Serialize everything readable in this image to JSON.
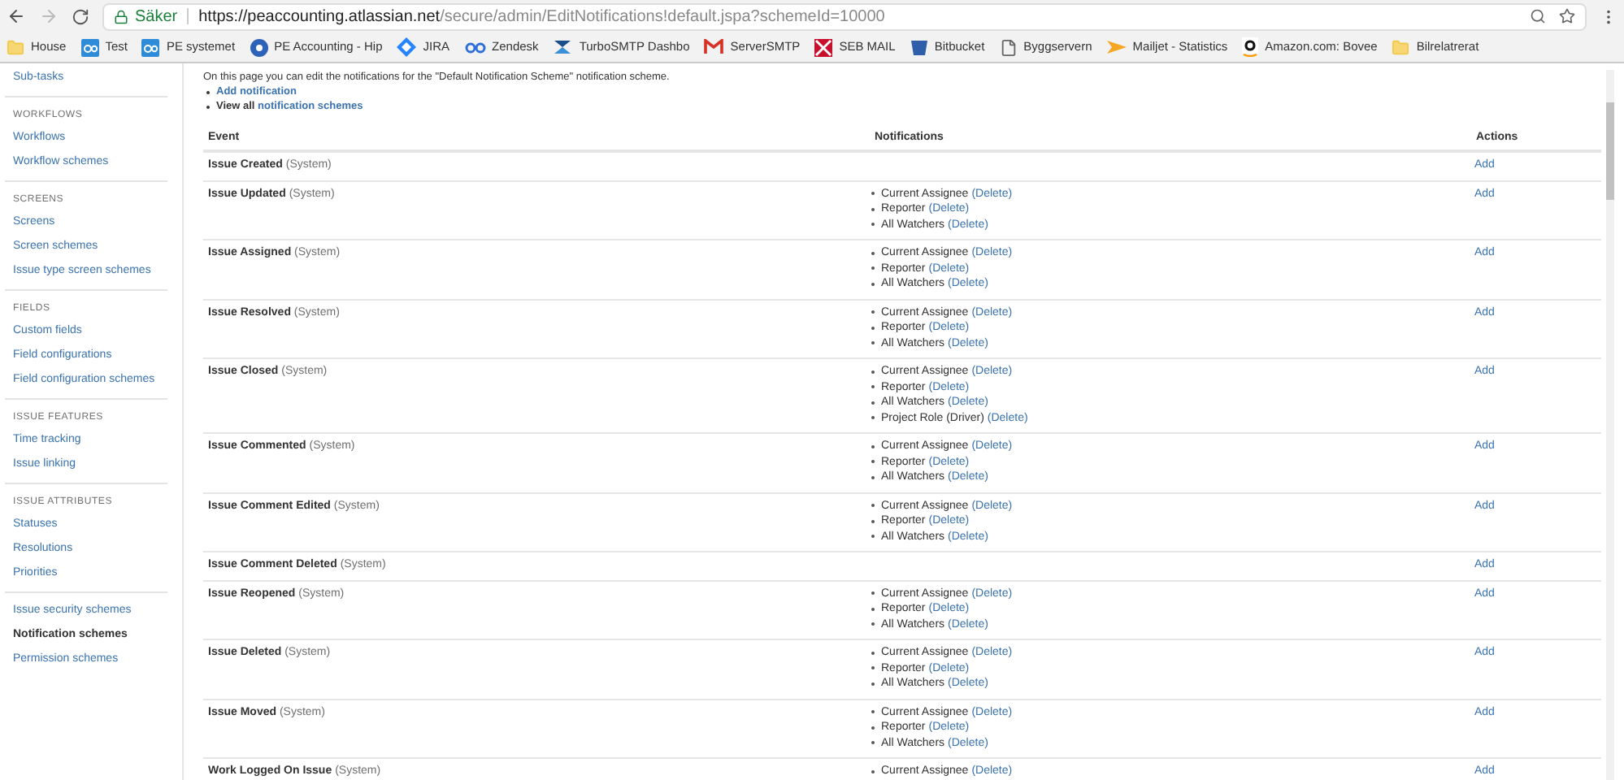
{
  "browser": {
    "secure_label": "Säker",
    "url_host": "https://peaccounting.atlassian.net",
    "url_path": "/secure/admin/EditNotifications!default.jspa?schemeId=10000"
  },
  "bookmarks": [
    {
      "kind": "folder",
      "label": "House"
    },
    {
      "kind": "pe",
      "label": "Test"
    },
    {
      "kind": "pe",
      "label": "PE systemet"
    },
    {
      "kind": "chat",
      "label": "PE Accounting - Hip"
    },
    {
      "kind": "jira",
      "label": "JIRA"
    },
    {
      "kind": "pe-text",
      "label": "Zendesk"
    },
    {
      "kind": "turbo",
      "label": "TurboSMTP Dashbo"
    },
    {
      "kind": "gmail",
      "label": "ServerSMTP"
    },
    {
      "kind": "seb",
      "label": "SEB MAIL"
    },
    {
      "kind": "bitbucket",
      "label": "Bitbucket"
    },
    {
      "kind": "page",
      "label": "Byggservern"
    },
    {
      "kind": "mailjet",
      "label": "Mailjet - Statistics"
    },
    {
      "kind": "amazon",
      "label": "Amazon.com: Bovee"
    },
    {
      "kind": "folder",
      "label": "Bilrelatrerat"
    }
  ],
  "sidebar": [
    {
      "items": [
        {
          "label": "Sub-tasks",
          "selected": false
        }
      ]
    },
    {
      "heading": "WORKFLOWS",
      "items": [
        {
          "label": "Workflows",
          "selected": false
        },
        {
          "label": "Workflow schemes",
          "selected": false
        }
      ]
    },
    {
      "heading": "SCREENS",
      "items": [
        {
          "label": "Screens",
          "selected": false
        },
        {
          "label": "Screen schemes",
          "selected": false
        },
        {
          "label": "Issue type screen schemes",
          "selected": false
        }
      ]
    },
    {
      "heading": "FIELDS",
      "items": [
        {
          "label": "Custom fields",
          "selected": false
        },
        {
          "label": "Field configurations",
          "selected": false
        },
        {
          "label": "Field configuration schemes",
          "selected": false
        }
      ]
    },
    {
      "heading": "ISSUE FEATURES",
      "items": [
        {
          "label": "Time tracking",
          "selected": false
        },
        {
          "label": "Issue linking",
          "selected": false
        }
      ]
    },
    {
      "heading": "ISSUE ATTRIBUTES",
      "items": [
        {
          "label": "Statuses",
          "selected": false
        },
        {
          "label": "Resolutions",
          "selected": false
        },
        {
          "label": "Priorities",
          "selected": false
        }
      ]
    },
    {
      "items": [
        {
          "label": "Issue security schemes",
          "selected": false
        },
        {
          "label": "Notification schemes",
          "selected": true
        },
        {
          "label": "Permission schemes",
          "selected": false
        }
      ]
    }
  ],
  "intro": {
    "text": "On this page you can edit the notifications for the \"Default Notification Scheme\" notification scheme.",
    "add_link": "Add notification",
    "view_all_prefix": "View all",
    "view_all_link": "notification schemes"
  },
  "table": {
    "columns": [
      "Event",
      "Notifications",
      "Actions"
    ],
    "rows": [
      {
        "event": "Issue Created",
        "tag": "(System)",
        "notifications": [],
        "action": "Add"
      },
      {
        "event": "Issue Updated",
        "tag": "(System)",
        "notifications": [
          {
            "label": "Current Assignee",
            "action": "(Delete)"
          },
          {
            "label": "Reporter",
            "action": "(Delete)"
          },
          {
            "label": "All Watchers",
            "action": "(Delete)"
          }
        ],
        "action": "Add"
      },
      {
        "event": "Issue Assigned",
        "tag": "(System)",
        "notifications": [
          {
            "label": "Current Assignee",
            "action": "(Delete)"
          },
          {
            "label": "Reporter",
            "action": "(Delete)"
          },
          {
            "label": "All Watchers",
            "action": "(Delete)"
          }
        ],
        "action": "Add"
      },
      {
        "event": "Issue Resolved",
        "tag": "(System)",
        "notifications": [
          {
            "label": "Current Assignee",
            "action": "(Delete)"
          },
          {
            "label": "Reporter",
            "action": "(Delete)"
          },
          {
            "label": "All Watchers",
            "action": "(Delete)"
          }
        ],
        "action": "Add"
      },
      {
        "event": "Issue Closed",
        "tag": "(System)",
        "notifications": [
          {
            "label": "Current Assignee",
            "action": "(Delete)"
          },
          {
            "label": "Reporter",
            "action": "(Delete)"
          },
          {
            "label": "All Watchers",
            "action": "(Delete)"
          },
          {
            "label": "Project Role (Driver)",
            "action": "(Delete)"
          }
        ],
        "action": "Add"
      },
      {
        "event": "Issue Commented",
        "tag": "(System)",
        "notifications": [
          {
            "label": "Current Assignee",
            "action": "(Delete)"
          },
          {
            "label": "Reporter",
            "action": "(Delete)"
          },
          {
            "label": "All Watchers",
            "action": "(Delete)"
          }
        ],
        "action": "Add"
      },
      {
        "event": "Issue Comment Edited",
        "tag": "(System)",
        "notifications": [
          {
            "label": "Current Assignee",
            "action": "(Delete)"
          },
          {
            "label": "Reporter",
            "action": "(Delete)"
          },
          {
            "label": "All Watchers",
            "action": "(Delete)"
          }
        ],
        "action": "Add"
      },
      {
        "event": "Issue Comment Deleted",
        "tag": "(System)",
        "notifications": [],
        "action": "Add"
      },
      {
        "event": "Issue Reopened",
        "tag": "(System)",
        "notifications": [
          {
            "label": "Current Assignee",
            "action": "(Delete)"
          },
          {
            "label": "Reporter",
            "action": "(Delete)"
          },
          {
            "label": "All Watchers",
            "action": "(Delete)"
          }
        ],
        "action": "Add"
      },
      {
        "event": "Issue Deleted",
        "tag": "(System)",
        "notifications": [
          {
            "label": "Current Assignee",
            "action": "(Delete)"
          },
          {
            "label": "Reporter",
            "action": "(Delete)"
          },
          {
            "label": "All Watchers",
            "action": "(Delete)"
          }
        ],
        "action": "Add"
      },
      {
        "event": "Issue Moved",
        "tag": "(System)",
        "notifications": [
          {
            "label": "Current Assignee",
            "action": "(Delete)"
          },
          {
            "label": "Reporter",
            "action": "(Delete)"
          },
          {
            "label": "All Watchers",
            "action": "(Delete)"
          }
        ],
        "action": "Add"
      },
      {
        "event": "Work Logged On Issue",
        "tag": "(System)",
        "notifications": [
          {
            "label": "Current Assignee",
            "action": "(Delete)"
          }
        ],
        "action": "Add"
      }
    ]
  }
}
